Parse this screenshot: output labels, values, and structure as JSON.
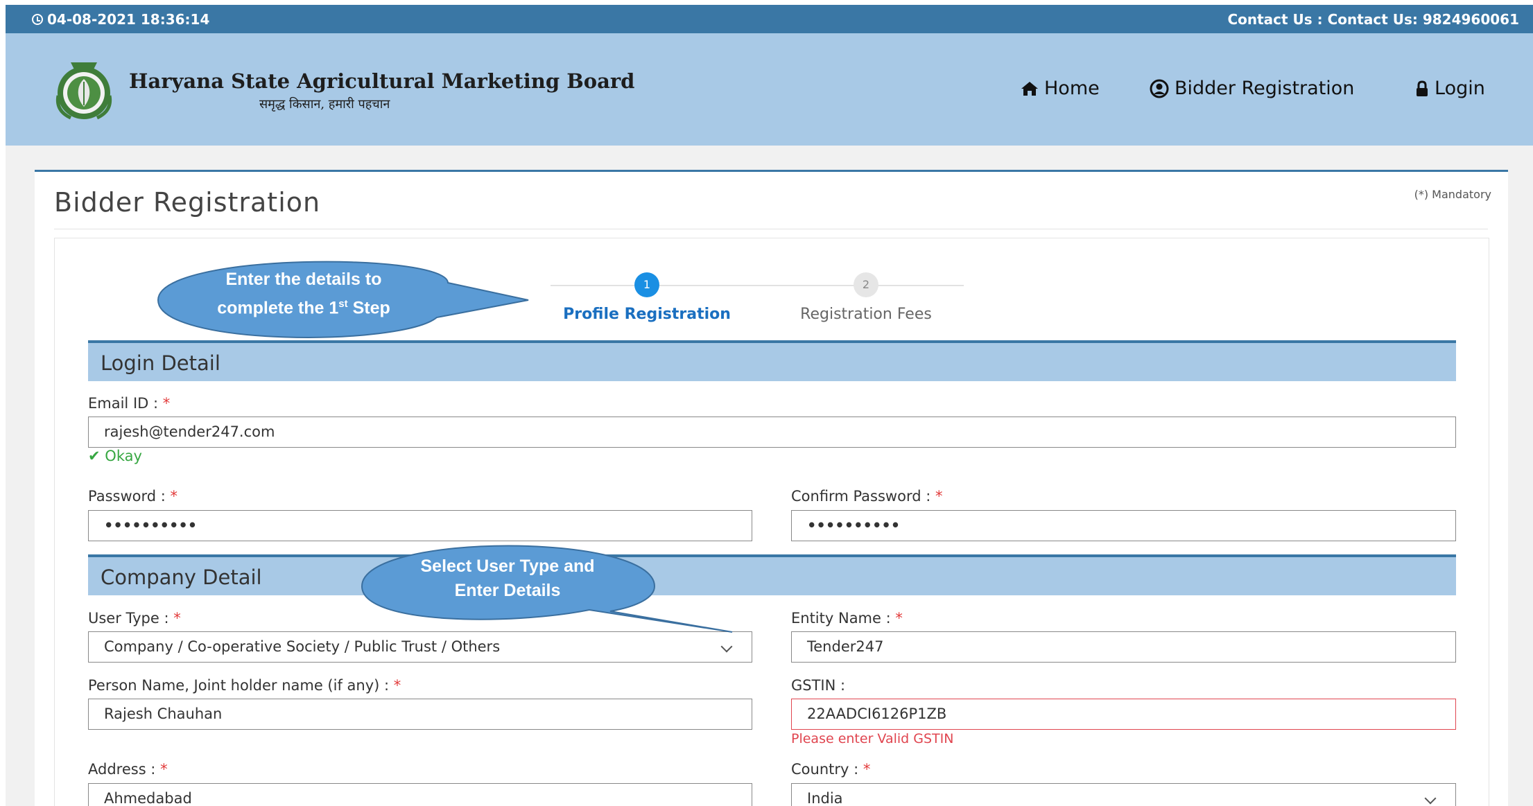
{
  "topbar": {
    "datetime": "04-08-2021 18:36:14",
    "contact": "Contact Us : Contact Us: 9824960061"
  },
  "header": {
    "org_name": "Haryana State Agricultural Marketing Board",
    "tagline": "समृद्ध किसान, हमारी पहचान",
    "nav": {
      "home": "Home",
      "bidder_registration": "Bidder Registration",
      "login": "Login"
    }
  },
  "page": {
    "title": "Bidder Registration",
    "mandatory_note": "(*) Mandatory"
  },
  "steps": [
    {
      "number": "1",
      "label": "Profile Registration",
      "active": true
    },
    {
      "number": "2",
      "label": "Registration Fees",
      "active": false
    }
  ],
  "callouts": {
    "step1_line1": "Enter the details to",
    "step1_line2_pre": "complete the 1",
    "step1_line2_sup": "st",
    "step1_line2_post": " Step",
    "usertype_line1": "Select User Type and",
    "usertype_line2": "Enter Details"
  },
  "login_detail": {
    "heading": "Login Detail",
    "email_label": "Email ID :",
    "email_value": "rajesh@tender247.com",
    "email_status": "Okay",
    "password_label": "Password :",
    "password_value": "••••••••••",
    "confirm_label": "Confirm Password :",
    "confirm_value": "••••••••••"
  },
  "company_detail": {
    "heading": "Company Detail",
    "user_type_label": "User Type :",
    "user_type_value": "Company / Co-operative Society / Public Trust / Others",
    "entity_label": "Entity Name :",
    "entity_value": "Tender247",
    "person_label": "Person Name, Joint holder name (if any) :",
    "person_value": "Rajesh Chauhan",
    "gstin_label": "GSTIN :",
    "gstin_value": "22AADCI6126P1ZB",
    "gstin_error": "Please enter Valid GSTIN",
    "address_label": "Address :",
    "address_value": "Ahmedabad",
    "country_label": "Country :",
    "country_value": "India"
  },
  "required_marker": "*",
  "colors": {
    "topbar": "#3a77a5",
    "header": "#a8c9e6",
    "active_step": "#1a8fe3",
    "callout": "#5b9bd5",
    "error": "#e0454f",
    "ok": "#37a742"
  }
}
